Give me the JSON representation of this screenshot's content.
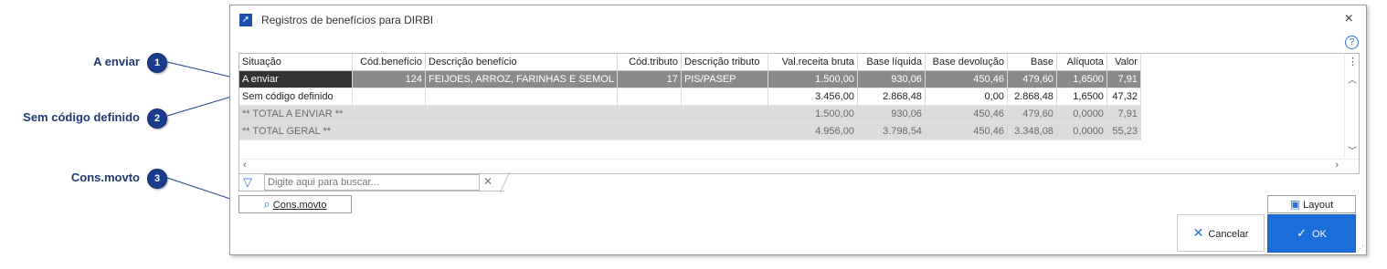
{
  "callouts": [
    {
      "number": "1",
      "label": "A enviar"
    },
    {
      "number": "2",
      "label": "Sem código definido"
    },
    {
      "number": "3",
      "label": "Cons.movto"
    }
  ],
  "window": {
    "title": "Registros de benefícios para DIRBI",
    "close_icon": "×",
    "help_icon": "?"
  },
  "grid": {
    "columns": [
      "Situação",
      "Cód.benefício",
      "Descrição benefício",
      "Cód.tributo",
      "Descrição tributo",
      "Val.receita bruta",
      "Base líquida",
      "Base devolução",
      "Base",
      "Alíquota",
      "Valor"
    ],
    "rows": [
      [
        "A enviar",
        "124",
        "FEIJOES, ARROZ, FARINHAS E SEMOL",
        "17",
        "PIS/PASEP",
        "1.500,00",
        "930,06",
        "450,46",
        "479,60",
        "1,6500",
        "7,91"
      ],
      [
        "Sem código definido",
        "",
        "",
        "",
        "",
        "3.456,00",
        "2.868,48",
        "0,00",
        "2.868,48",
        "1,6500",
        "47,32"
      ],
      [
        "** TOTAL A ENVIAR **",
        "",
        "",
        "",
        "",
        "1.500,00",
        "930,06",
        "450,46",
        "479,60",
        "0,0000",
        "7,91"
      ],
      [
        "** TOTAL GERAL **",
        "",
        "",
        "",
        "",
        "4.956,00",
        "3.798,54",
        "450,46",
        "3.348,08",
        "0,0000",
        "55,23"
      ]
    ]
  },
  "search": {
    "placeholder": "Digite aqui para buscar..."
  },
  "buttons": {
    "cons_movto": "Cons.movto",
    "layout": "Layout",
    "cancel": "Cancelar",
    "ok": "OK"
  },
  "colors": {
    "badge": "#1a3c8c",
    "ok_button": "#1b6ed8",
    "selected_row": "#8a8a8a"
  }
}
